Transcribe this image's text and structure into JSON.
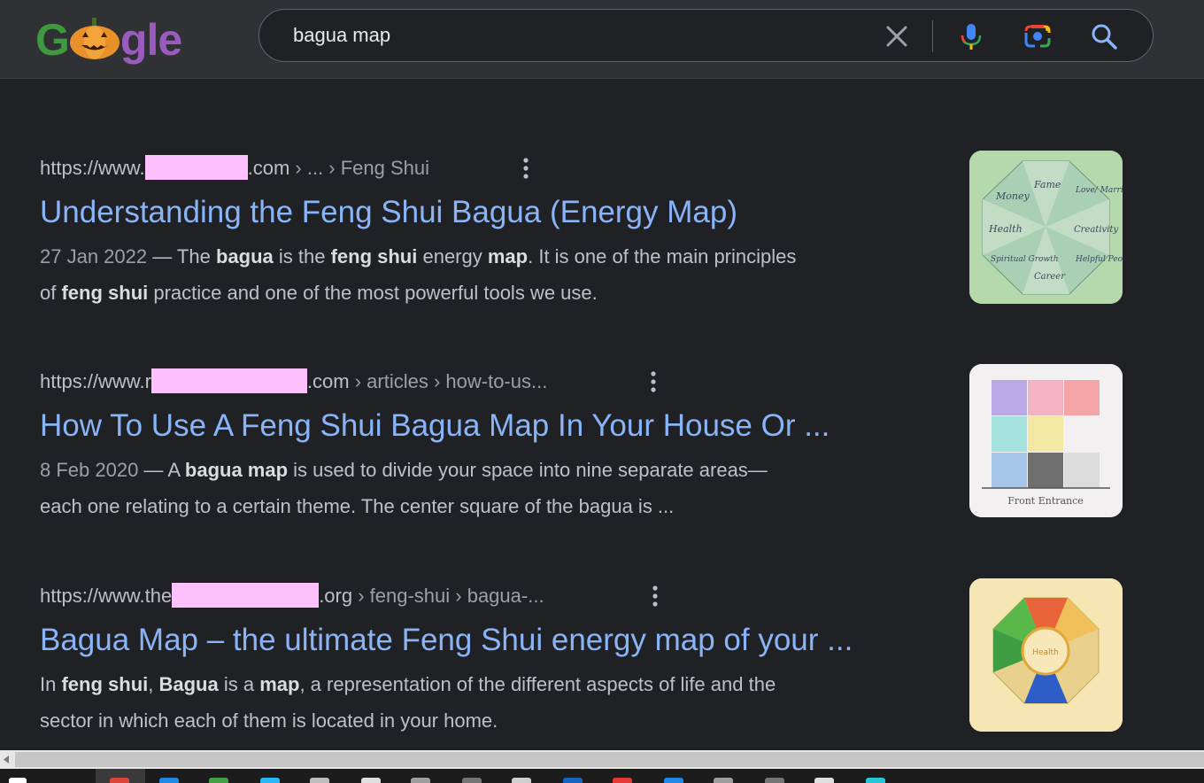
{
  "search": {
    "query": "bagua map",
    "clear_label": "Clear",
    "voice_label": "Search by voice",
    "lens_label": "Search by image",
    "submit_label": "Search"
  },
  "logo": {
    "first": "G",
    "rest": "gle"
  },
  "results": [
    {
      "cite_prefix": "https://www.",
      "cite_suffix": ".com",
      "cite_path": " › ... › Feng Shui",
      "title": "Understanding the Feng Shui Bagua (Energy Map)",
      "date": "27 Jan 2022",
      "snippet_line1_pre": " — The ",
      "b1": "bagua",
      "t1": " is the ",
      "b2": "feng shui",
      "t2": " energy ",
      "b3": "map",
      "t3": ". It is one of the main principles",
      "t4": "of ",
      "b4": "feng shui",
      "t5": " practice and one of the most powerful tools we use.",
      "thumb_labels": [
        "Fame",
        "Love/ Marriage",
        "Creativity",
        "Helpful People",
        "Career",
        "Spiritual Growth",
        "Health",
        "Money"
      ]
    },
    {
      "cite_prefix": "https://www.r",
      "cite_suffix": ".com",
      "cite_path": " › articles › how-to-us...",
      "title": "How To Use A Feng Shui Bagua Map In Your House Or ...",
      "date": "8 Feb 2020",
      "t0": " — A ",
      "b1": "bagua map",
      "t1": " is used to divide your space into nine separate areas—",
      "t2": "each one relating to a certain theme. The center square of the bagua is ...",
      "thumb_caption": "Front Entrance"
    },
    {
      "cite_prefix": "https://www.the",
      "cite_suffix": ".org",
      "cite_path": " › feng-shui › bagua-...",
      "title": "Bagua Map – the ultimate Feng Shui energy map of your ...",
      "t0": "In ",
      "b1": "feng shui",
      "t1": ", ",
      "b2": "Bagua",
      "t2": " is a ",
      "b3": "map",
      "t3": ", a representation of the different aspects of life and the",
      "t4": "sector in which each of them is located in your home.",
      "thumb_center": "Health"
    }
  ],
  "colors": {
    "background": "#202124",
    "header": "#303134",
    "link": "#8ab4f8",
    "redaction": "#ffc0ff"
  }
}
